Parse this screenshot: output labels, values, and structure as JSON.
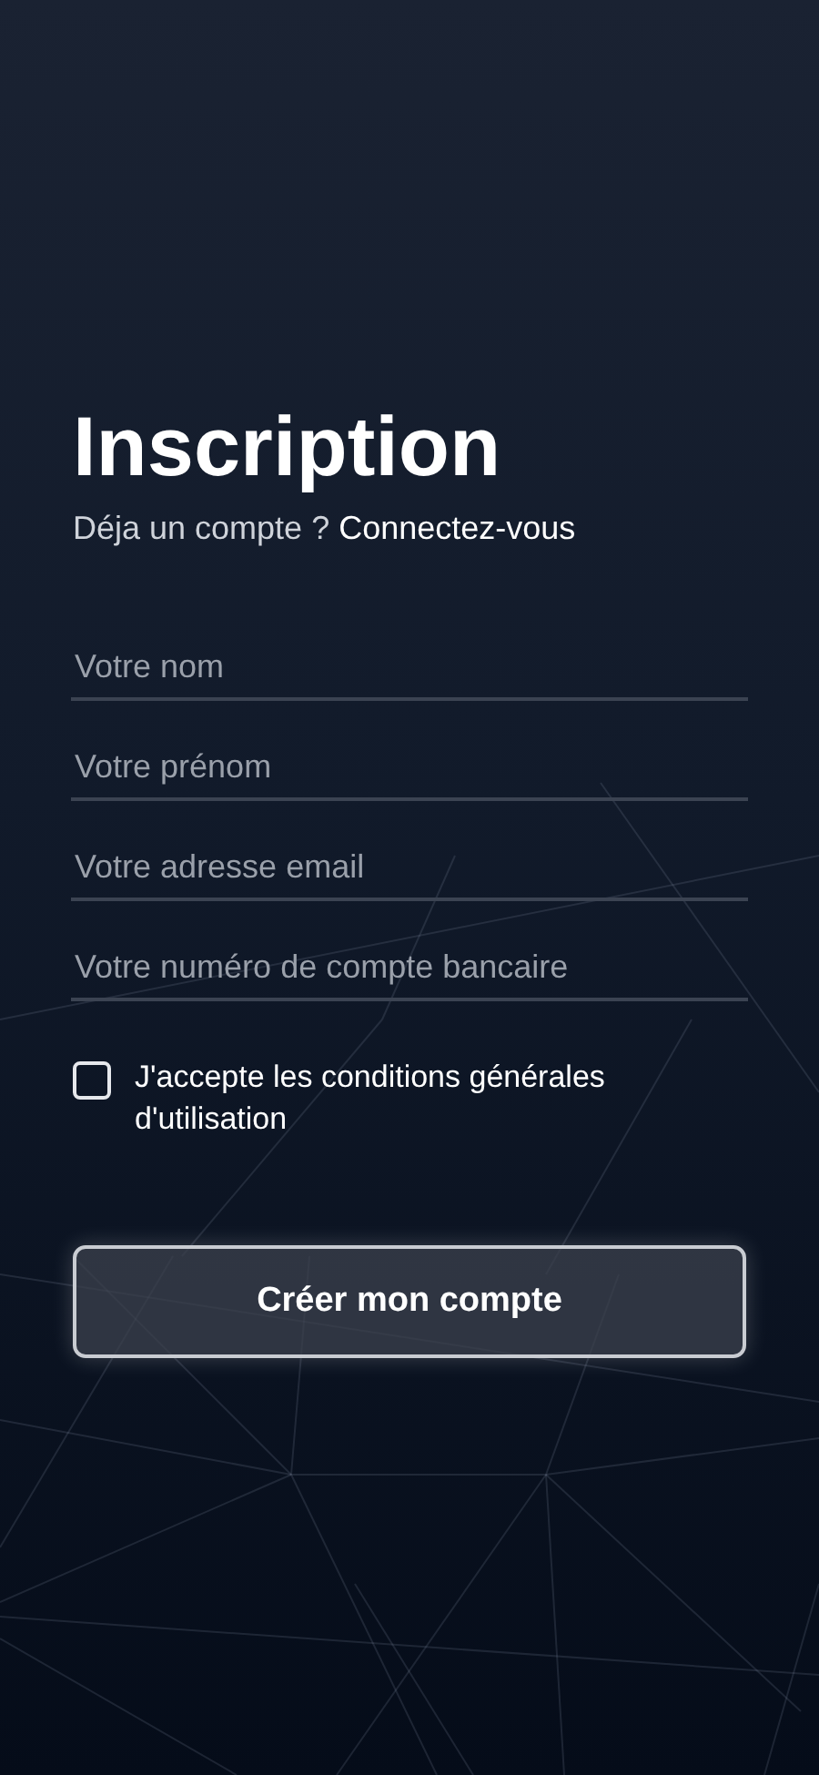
{
  "title": "Inscription",
  "login_prompt": {
    "text": "Déja un compte ?",
    "link": "Connectez-vous"
  },
  "fields": [
    {
      "placeholder": "Votre nom"
    },
    {
      "placeholder": "Votre prénom"
    },
    {
      "placeholder": "Votre adresse email"
    },
    {
      "placeholder": "Votre numéro de compte bancaire"
    }
  ],
  "terms": {
    "label": "J'accepte les conditions générales d'utilisation",
    "checked": false
  },
  "submit_button": {
    "label": "Créer mon compte"
  }
}
